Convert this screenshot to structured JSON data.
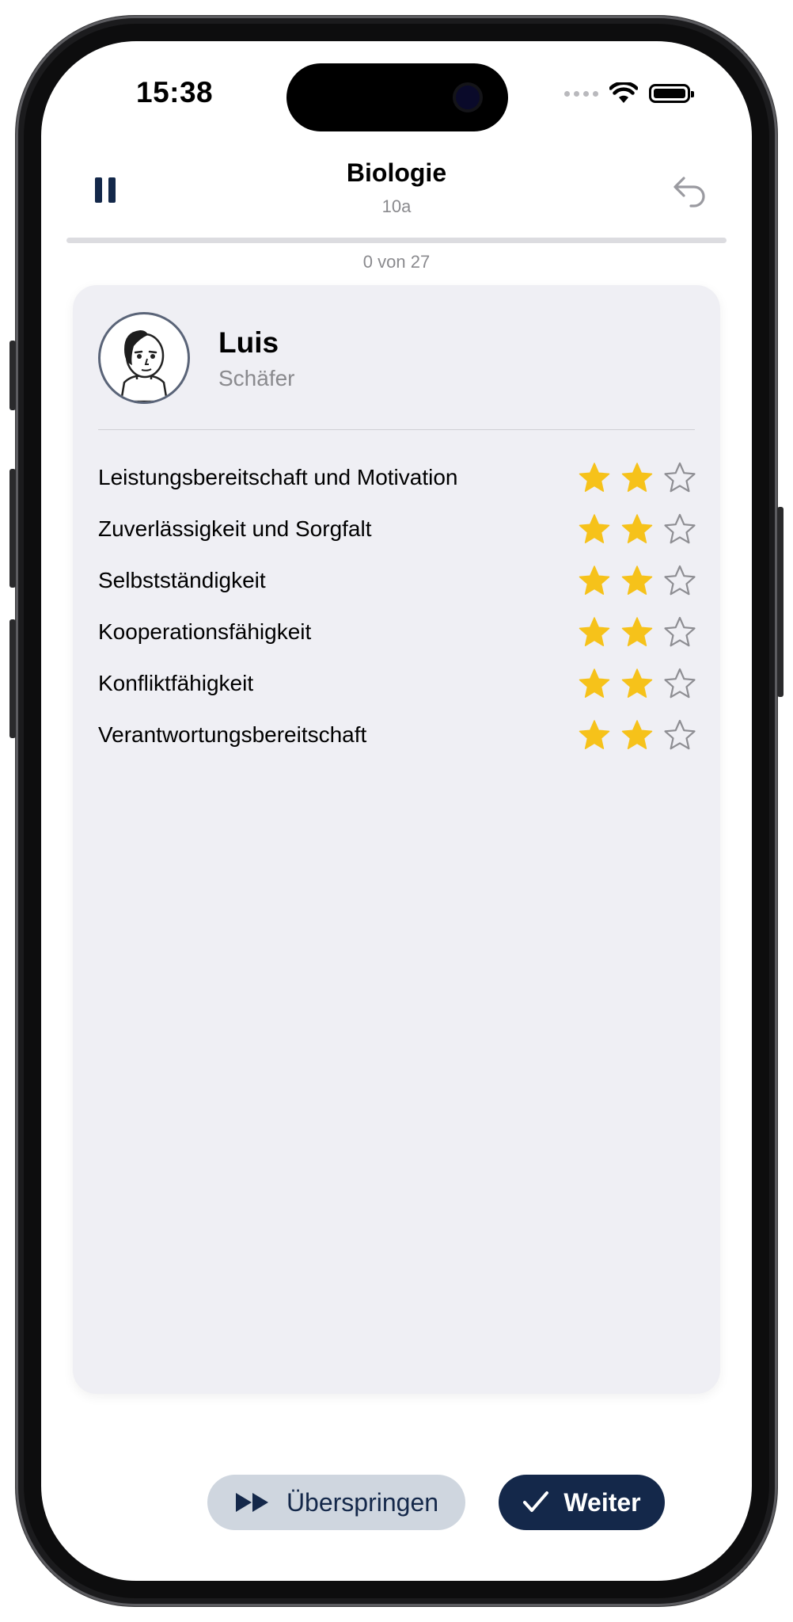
{
  "status_bar": {
    "time": "15:38"
  },
  "header": {
    "title": "Biologie",
    "subtitle": "10a"
  },
  "progress": {
    "text": "0 von 27",
    "fraction": 0
  },
  "student": {
    "first_name": "Luis",
    "last_name": "Schäfer"
  },
  "criteria": [
    {
      "label": "Leistungsbereitschaft und Motivation",
      "rating": 2,
      "max": 3
    },
    {
      "label": "Zuverlässigkeit und Sorgfalt",
      "rating": 2,
      "max": 3
    },
    {
      "label": "Selbstständigkeit",
      "rating": 2,
      "max": 3
    },
    {
      "label": "Kooperationsfähigkeit",
      "rating": 2,
      "max": 3
    },
    {
      "label": "Konfliktfähigkeit",
      "rating": 2,
      "max": 3
    },
    {
      "label": "Verantwortungsbereitschaft",
      "rating": 2,
      "max": 3
    }
  ],
  "buttons": {
    "skip_label": "Überspringen",
    "next_label": "Weiter"
  },
  "colors": {
    "accent": "#14284a",
    "star": "#f6c21a",
    "card": "#efeff4",
    "skip_bg": "#cfd6df"
  },
  "icons": {
    "pause": "pause-icon",
    "undo": "undo-icon",
    "skip": "fast-forward-icon",
    "next": "checkmark-icon"
  }
}
